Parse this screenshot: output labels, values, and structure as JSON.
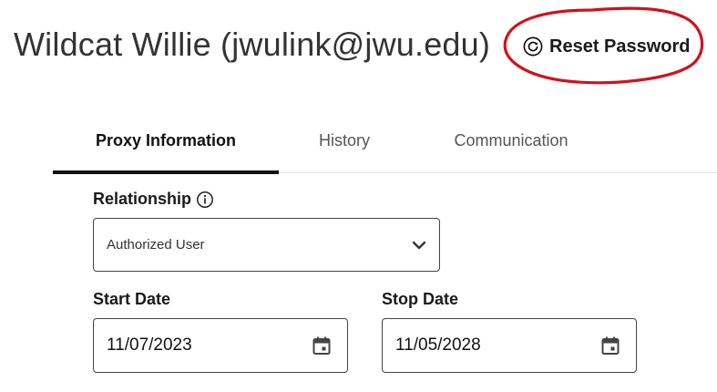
{
  "header": {
    "title": "Wildcat Willie (jwulink@jwu.edu)",
    "reset_label": "Reset Password",
    "reset_icon": "reset-icon",
    "annotation_color": "#d0121b"
  },
  "tabs": [
    {
      "label": "Proxy Information",
      "active": true
    },
    {
      "label": "History",
      "active": false
    },
    {
      "label": "Communication",
      "active": false
    }
  ],
  "form": {
    "relationship": {
      "label": "Relationship",
      "value": "Authorized User",
      "icon": "info-icon"
    },
    "start_date": {
      "label": "Start Date",
      "value": "11/07/2023",
      "icon": "calendar-icon"
    },
    "stop_date": {
      "label": "Stop Date",
      "value": "11/05/2028",
      "icon": "calendar-icon"
    }
  }
}
